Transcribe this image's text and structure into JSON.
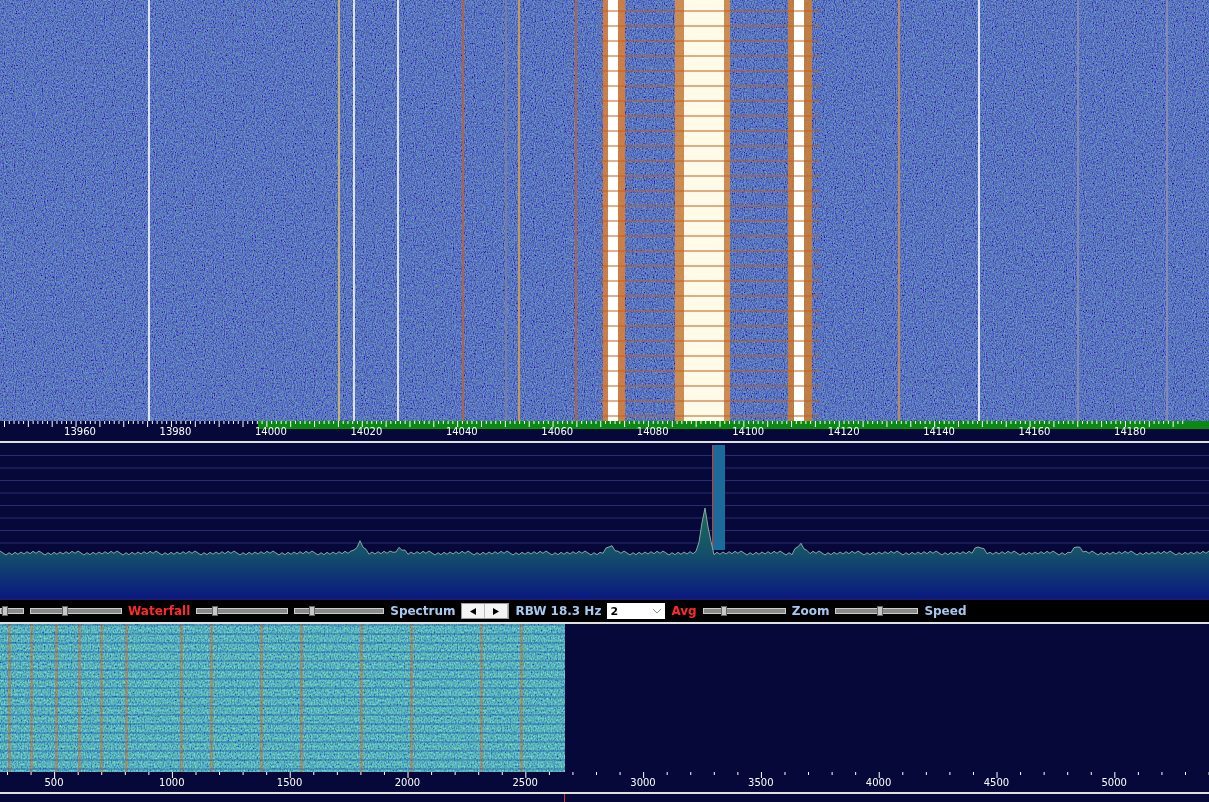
{
  "frequency_axis": {
    "labels": [
      "13960",
      "13980",
      "14000",
      "14020",
      "14040",
      "14060",
      "14080",
      "14100",
      "14120",
      "14140",
      "14160",
      "14180"
    ]
  },
  "controls": [
    {
      "kind": "slider",
      "level": 0.2
    },
    {
      "kind": "slider",
      "level": 0.38
    },
    {
      "kind": "label",
      "text": "Waterfall",
      "color": "#ff2a2a"
    },
    {
      "kind": "slider",
      "level": 0.2
    },
    {
      "kind": "slider",
      "level": 0.19
    },
    {
      "kind": "label",
      "text": "Spectrum",
      "color": "#a8c8f0"
    },
    {
      "kind": "stepper"
    },
    {
      "kind": "label",
      "text": "RBW 18.3 Hz",
      "color": "#a8c8f0"
    },
    {
      "kind": "select",
      "value": "2"
    },
    {
      "kind": "label",
      "text": "Avg",
      "color": "#ff2a2a"
    },
    {
      "kind": "slider",
      "level": 0.25
    },
    {
      "kind": "label",
      "text": "Zoom",
      "color": "#a8c8f0"
    },
    {
      "kind": "slider",
      "level": 0.54
    },
    {
      "kind": "label",
      "text": "Speed",
      "color": "#a8c8f0"
    }
  ],
  "audio_axis": {
    "labels": [
      "500",
      "1000",
      "1500",
      "2000",
      "2500",
      "3000",
      "3500",
      "4000",
      "4500",
      "5000"
    ]
  }
}
